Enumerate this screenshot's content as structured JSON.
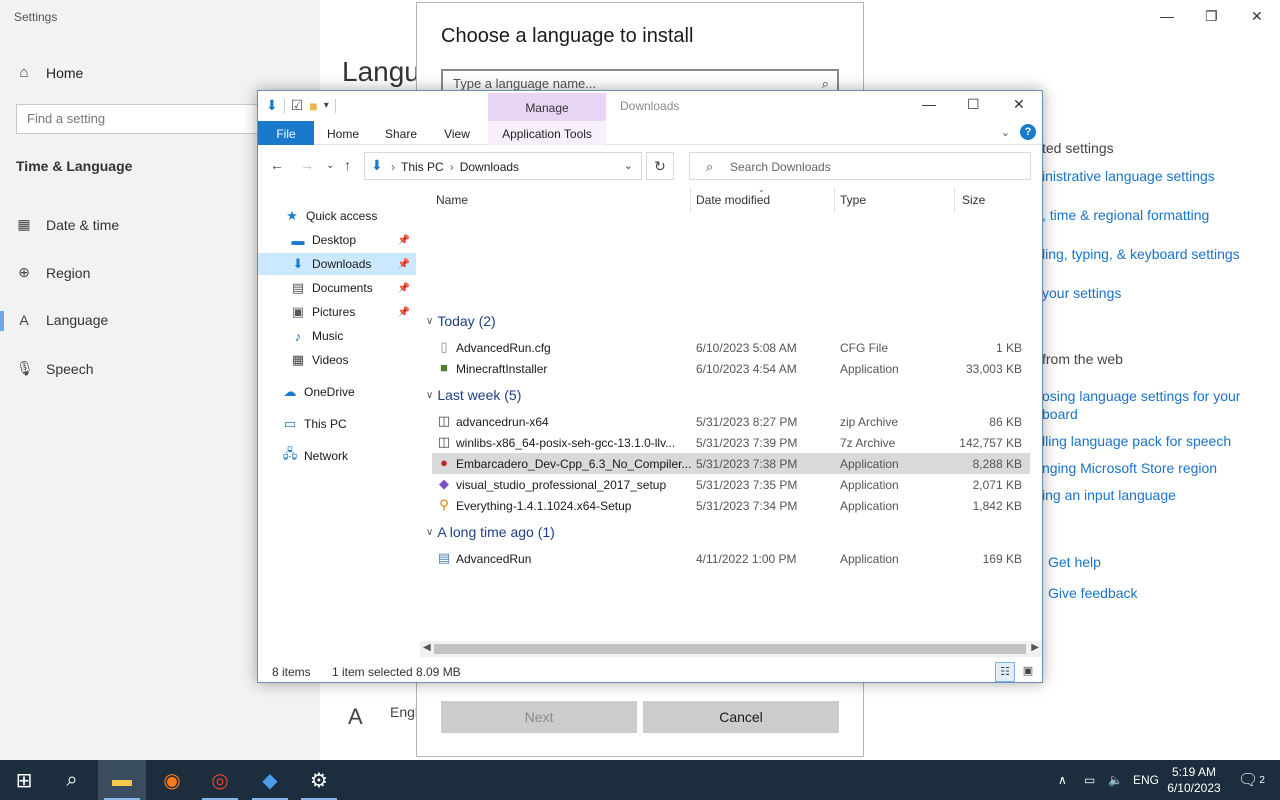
{
  "settings": {
    "window_title": "Settings",
    "home_label": "Home",
    "find_placeholder": "Find a setting",
    "category": "Time & Language",
    "nav": [
      "Date & time",
      "Region",
      "Language",
      "Speech"
    ],
    "heading_partial": "Langu",
    "related_heading_partial": "ted settings",
    "related_links_partial": [
      "inistrative language settings",
      ", time & regional formatting",
      "ling, typing, & keyboard settings",
      "your settings"
    ],
    "web_heading_partial": "from the web",
    "web_links_partial": [
      "osing language settings for your",
      "board",
      "lling language pack for speech",
      "nging Microsoft Store region",
      "ing an input language"
    ],
    "get_help": "Get help",
    "give_feedback": "Give feedback",
    "lang_footer_partial": "Engl"
  },
  "dialog": {
    "title": "Choose a language to install",
    "search_placeholder": "Type a language name...",
    "next_label": "Next",
    "cancel_label": "Cancel"
  },
  "explorer": {
    "title": "Downloads",
    "manage_tab": "Manage",
    "ribbon_tabs": [
      "File",
      "Home",
      "Share",
      "View",
      "Application Tools"
    ],
    "breadcrumb": [
      "This PC",
      "Downloads"
    ],
    "search_placeholder": "Search Downloads",
    "nav_pane": {
      "quick_access": "Quick access",
      "desktop": "Desktop",
      "downloads": "Downloads",
      "documents": "Documents",
      "pictures": "Pictures",
      "music": "Music",
      "videos": "Videos",
      "onedrive": "OneDrive",
      "this_pc": "This PC",
      "network": "Network"
    },
    "columns": [
      "Name",
      "Date modified",
      "Type",
      "Size"
    ],
    "groups": [
      {
        "label": "Today (2)",
        "files": [
          {
            "name": "AdvancedRun.cfg",
            "date": "6/10/2023 5:08 AM",
            "type": "CFG File",
            "size": "1 KB"
          },
          {
            "name": "MinecraftInstaller",
            "date": "6/10/2023 4:54 AM",
            "type": "Application",
            "size": "33,003 KB"
          }
        ]
      },
      {
        "label": "Last week (5)",
        "files": [
          {
            "name": "advancedrun-x64",
            "date": "5/31/2023 8:27 PM",
            "type": "zip Archive",
            "size": "86 KB"
          },
          {
            "name": "winlibs-x86_64-posix-seh-gcc-13.1.0-llv...",
            "date": "5/31/2023 7:39 PM",
            "type": "7z Archive",
            "size": "142,757 KB"
          },
          {
            "name": "Embarcadero_Dev-Cpp_6.3_No_Compiler...",
            "date": "5/31/2023 7:38 PM",
            "type": "Application",
            "size": "8,288 KB"
          },
          {
            "name": "visual_studio_professional_2017_setup",
            "date": "5/31/2023 7:35 PM",
            "type": "Application",
            "size": "2,071 KB"
          },
          {
            "name": "Everything-1.4.1.1024.x64-Setup",
            "date": "5/31/2023 7:34 PM",
            "type": "Application",
            "size": "1,842 KB"
          }
        ]
      },
      {
        "label": "A long time ago (1)",
        "files": [
          {
            "name": "AdvancedRun",
            "date": "4/11/2022 1:00 PM",
            "type": "Application",
            "size": "169 KB"
          }
        ]
      }
    ],
    "status": {
      "items": "8 items",
      "selected": "1 item selected",
      "size": "8.09 MB"
    }
  },
  "taskbar": {
    "lang": "ENG",
    "time": "5:19 AM",
    "date": "6/10/2023",
    "notifications": "2"
  }
}
